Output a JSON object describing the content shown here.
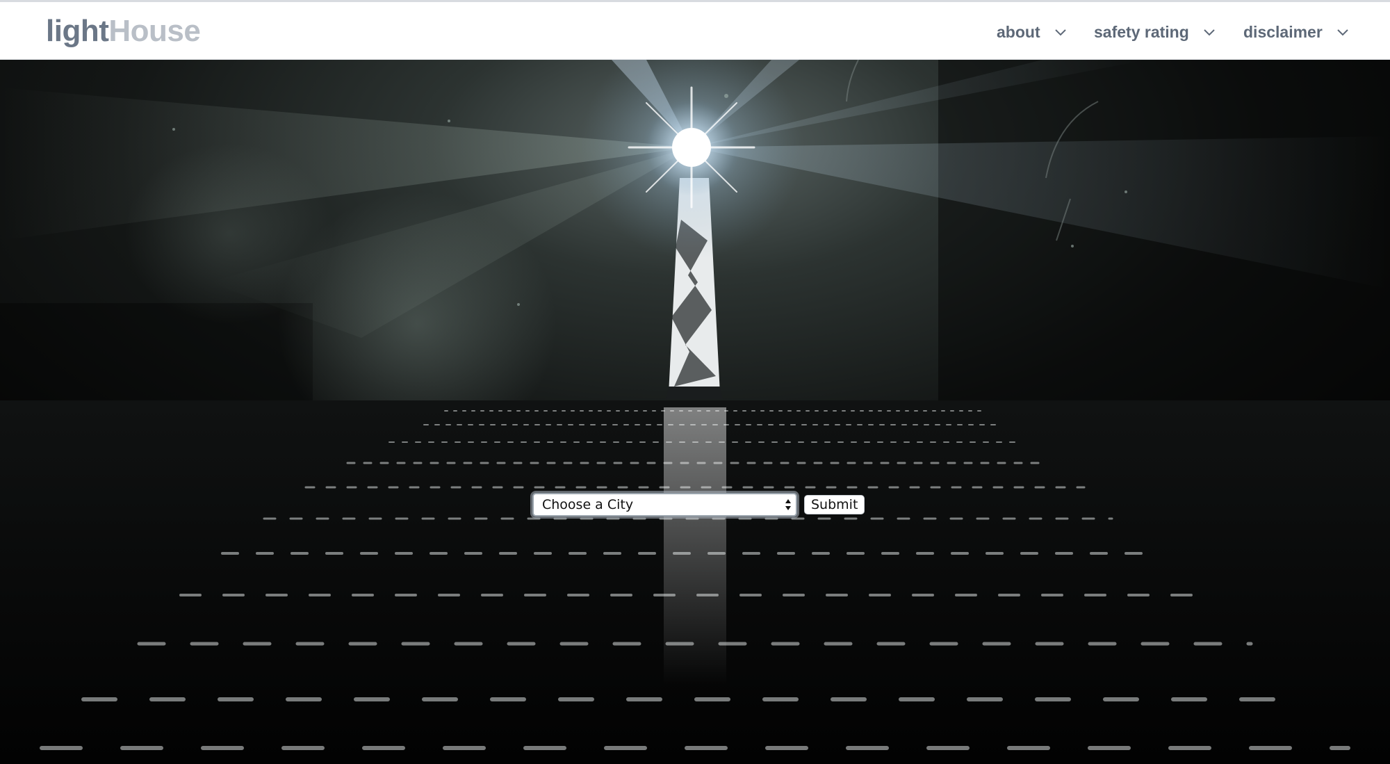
{
  "navbar": {
    "brand_part1": "light",
    "brand_part2": "House",
    "items": [
      {
        "label": "about",
        "icon": "chevron-down-icon"
      },
      {
        "label": "safety rating",
        "icon": "chevron-down-icon"
      },
      {
        "label": "disclaimer",
        "icon": "chevron-down-icon"
      }
    ]
  },
  "hero": {
    "background": "lighthouse-at-night-over-water"
  },
  "form": {
    "city_select_value": "Choose a City",
    "submit_label": "Submit"
  },
  "colors": {
    "nav_text": "#5d6877",
    "brand_dark": "#6b7787",
    "brand_light": "#b9bfc7",
    "navbar_bg": "#ffffff"
  }
}
